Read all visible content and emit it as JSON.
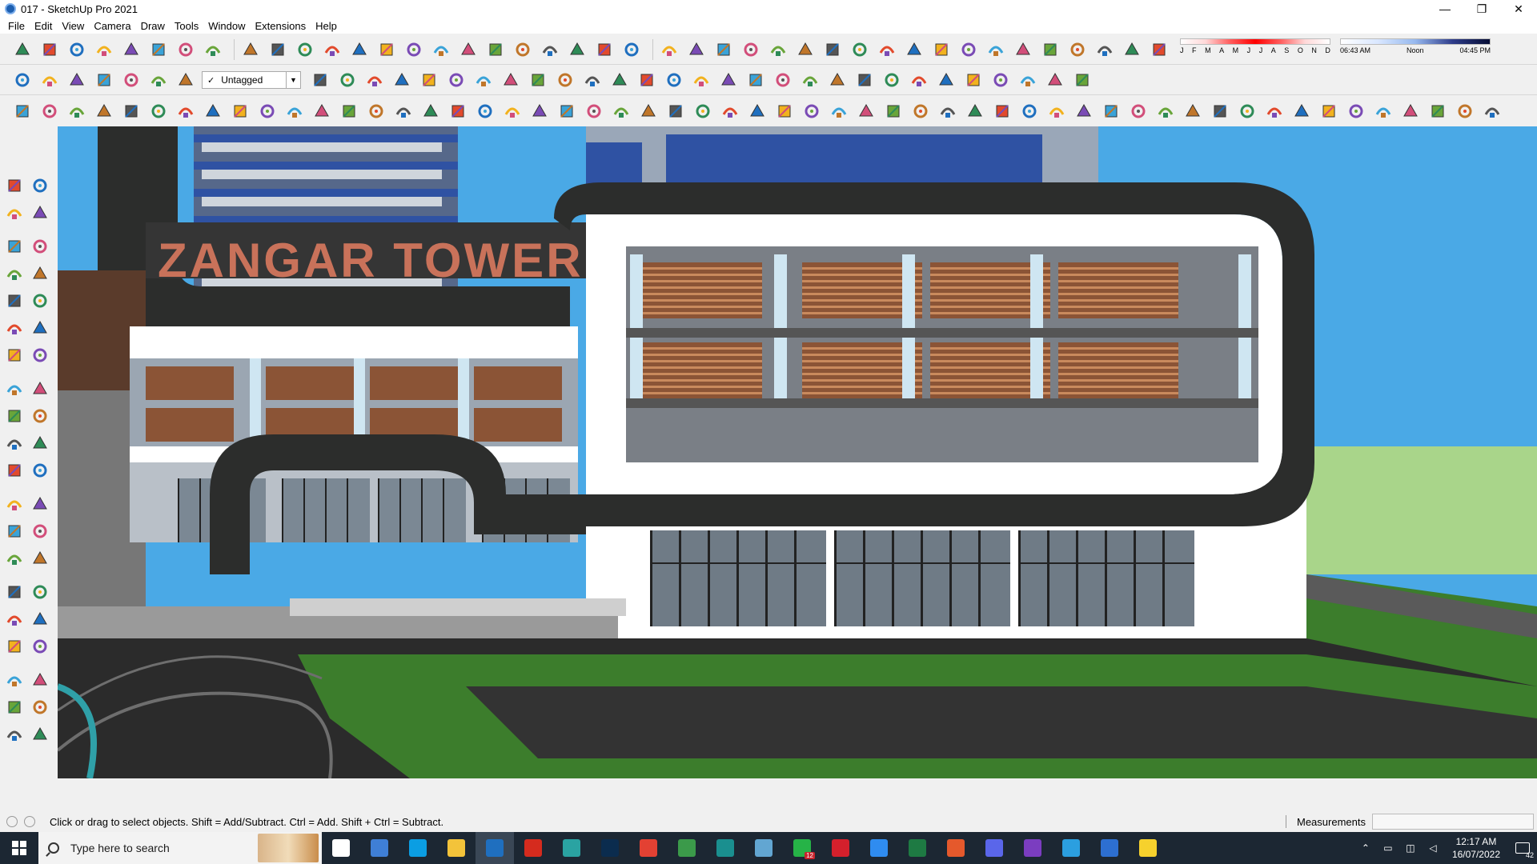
{
  "window": {
    "title": "017 - SketchUp Pro 2021",
    "minimize": "—",
    "maximize": "❐",
    "close": "✕"
  },
  "menu": [
    "File",
    "Edit",
    "View",
    "Camera",
    "Draw",
    "Tools",
    "Window",
    "Extensions",
    "Help"
  ],
  "tag_dropdown": {
    "check": "✓",
    "value": "Untagged"
  },
  "shadow": {
    "months": [
      "J",
      "F",
      "M",
      "A",
      "M",
      "J",
      "J",
      "A",
      "S",
      "O",
      "N",
      "D"
    ],
    "time_start": "06:43 AM",
    "time_mid": "Noon",
    "time_end": "04:45 PM"
  },
  "scene": {
    "sign_text": "ZANGAR TOWER",
    "colors": {
      "sky": "#4aa9e6",
      "grass": "#3c7d2c",
      "road": "#2b2b2b",
      "frame": "#2c2d2c",
      "wood": "#8b5436",
      "glass_blue": "#2f52a3",
      "white": "#ffffff",
      "sign": "#c9725a"
    }
  },
  "toolbar_icons": {
    "row1": [
      "sandbox-icon",
      "sandbox-scratch-icon",
      "solid-outer-shell-icon",
      "solid-intersect-icon",
      "solid-union-icon",
      "solid-subtract-icon",
      "solid-trim-icon",
      "solid-split-icon",
      "arc-icon",
      "component-icon",
      "section-icon",
      "box-icon",
      "bucket-icon",
      "link-icon",
      "curve-icon",
      "bezier-icon",
      "add-icon",
      "move-icon",
      "scale-icon",
      "cone-icon",
      "pyramid-icon",
      "triangle-icon",
      "lasso-icon",
      "lasso-2-icon",
      "rotate-icon",
      "star-icon",
      "cube-icon",
      "undo-arc-icon",
      "extract-icon",
      "connector-icon",
      "object-icon",
      "box-2-icon",
      "paint-icon",
      "settings-icon",
      "grid-icon",
      "window-icon",
      "grid-2-icon",
      "grid-3-icon",
      "scatter-icon",
      "loop-icon",
      "network-icon",
      "eraser-icon"
    ],
    "row2": [
      "cube-view-icon",
      "top-view-icon",
      "front-view-icon",
      "house-icon",
      "house-2-icon",
      "house-3-icon",
      "garage-icon",
      "pushpull-icon",
      "arrow-up-icon",
      "arrow-r-icon",
      "arrow-g-icon",
      "arrow-b-icon",
      "arrow-o-icon",
      "arrow-f-icon",
      "arrow-t-icon",
      "tag-icon",
      "section-cut-icon",
      "section-cut-2-icon",
      "section-cut-3-icon",
      "display-icon",
      "display-2-icon",
      "fill-icon",
      "align-icon",
      "move-up-icon",
      "measure-icon",
      "fold-icon",
      "rotate-ccw-icon",
      "rotate-cw-icon",
      "hand-icon",
      "texture-icon",
      "texture-2-icon",
      "chair-icon",
      "sofa-icon",
      "bucket-2-icon",
      "box-3-icon",
      "ruler-icon"
    ],
    "row3": [
      "line-icon",
      "freehand-icon",
      "arc-2-icon",
      "cut-icon",
      "rotate-3d-icon",
      "rotate-3d-2-icon",
      "bend-icon",
      "sphere-icon",
      "sphere-2-icon",
      "arc-3-icon",
      "corner-icon",
      "corner-2-icon",
      "line-2-icon",
      "curve-2-icon",
      "measure-2-icon",
      "paint-2-icon",
      "stairs-icon",
      "stairs-2-icon",
      "hand-2-icon",
      "leaf-icon",
      "plane-icon",
      "loft-icon",
      "slide-icon",
      "split-icon",
      "split-2-icon",
      "split-3-icon",
      "bridge-icon",
      "stripe-icon",
      "stripe-2-icon",
      "chair-2-icon",
      "stripe-3-icon",
      "stripe-4-icon",
      "grid-4-icon",
      "grid-5-icon",
      "grid-6-icon",
      "grid-7-icon",
      "wheel-icon",
      "wheel-2-icon",
      "stripe-5-icon",
      "stripe-6-icon",
      "home-icon",
      "tag-2-icon",
      "pencil-icon",
      "ring-icon",
      "ring-2-icon",
      "ring-3-icon",
      "ring-4-icon",
      "ring-5-icon",
      "slope-icon",
      "loop-2-icon",
      "loop-3-icon",
      "lasso-3-icon",
      "lasso-4-icon",
      "axis-icon",
      "eraser-2-icon"
    ]
  },
  "left_tools": [
    "select-icon",
    "component-icon",
    "paint-bucket-icon",
    "eraser-icon",
    "pencil-icon",
    "freehand-icon",
    "rectangle-icon",
    "rotated-rectangle-icon",
    "circle-icon",
    "polygon-icon",
    "arc-icon",
    "arc-2pt-icon",
    "arc-3pt-icon",
    "pie-icon",
    "move-icon",
    "push-pull-icon",
    "rotate-icon",
    "follow-me-icon",
    "scale-icon",
    "offset-icon",
    "tape-measure-icon",
    "dimension-icon",
    "protractor-icon",
    "text-icon",
    "axes-icon",
    "3d-text-icon",
    "orbit-icon",
    "pan-icon",
    "zoom-icon",
    "zoom-window-icon",
    "zoom-extents-icon",
    "previous-view-icon",
    "position-camera-icon",
    "look-around-icon",
    "walk-icon",
    "section-plane-icon",
    "warehouse-icon",
    "extension-icon",
    "layers-icon",
    "layers-2-icon"
  ],
  "status": {
    "message": "Click or drag to select objects. Shift = Add/Subtract. Ctrl = Add. Shift + Ctrl = Subtract.",
    "measurements_label": "Measurements",
    "measurements_value": ""
  },
  "taskbar": {
    "search_placeholder": "Type here to search",
    "apps": [
      {
        "name": "task-view",
        "color": "#ffffff"
      },
      {
        "name": "calculator",
        "color": "#3f7fd6"
      },
      {
        "name": "edge",
        "color": "#0b9ee3"
      },
      {
        "name": "file-explorer",
        "color": "#f3c33a"
      },
      {
        "name": "sketchup",
        "color": "#1f6fbf",
        "active": true
      },
      {
        "name": "acrobat",
        "color": "#d52b1e"
      },
      {
        "name": "cad",
        "color": "#2aa3a2"
      },
      {
        "name": "photoshop",
        "color": "#0b2c4e"
      },
      {
        "name": "chrome",
        "color": "#e34133"
      },
      {
        "name": "chrome-2",
        "color": "#3b9a4a"
      },
      {
        "name": "app-teal",
        "color": "#1a8f8f"
      },
      {
        "name": "app-layers",
        "color": "#62a6d2"
      },
      {
        "name": "whatsapp",
        "color": "#26b347",
        "badge": "12"
      },
      {
        "name": "opera",
        "color": "#d4202c"
      },
      {
        "name": "todo",
        "color": "#2f8cf0"
      },
      {
        "name": "excel",
        "color": "#1e7a43"
      },
      {
        "name": "grammarly",
        "color": "#e5592c"
      },
      {
        "name": "discord",
        "color": "#5a66ea"
      },
      {
        "name": "app-purple",
        "color": "#7b3dc0"
      },
      {
        "name": "telegram",
        "color": "#2b9fe0"
      },
      {
        "name": "app-cube",
        "color": "#2d6fd1"
      },
      {
        "name": "sticky-notes",
        "color": "#f6d12d"
      }
    ],
    "time": "12:17 AM",
    "date": "16/07/2022",
    "notifications": "42",
    "tray_chevron": "⌃"
  }
}
